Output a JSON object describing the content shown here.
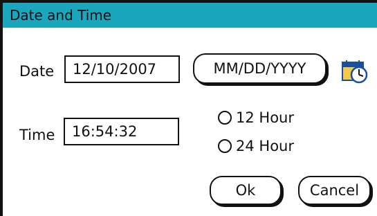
{
  "dialog": {
    "title": "Date and Time"
  },
  "date": {
    "label": "Date",
    "value": "12/10/2007",
    "format_button": "MM/DD/YYYY",
    "calendar_icon": "calendar-clock-icon"
  },
  "time": {
    "label": "Time",
    "value": "16:54:32",
    "options": [
      {
        "label": "12 Hour",
        "selected": false
      },
      {
        "label": "24 Hour",
        "selected": false
      }
    ]
  },
  "buttons": {
    "ok": "Ok",
    "cancel": "Cancel"
  },
  "colors": {
    "titlebar": "#1aa6bd"
  }
}
